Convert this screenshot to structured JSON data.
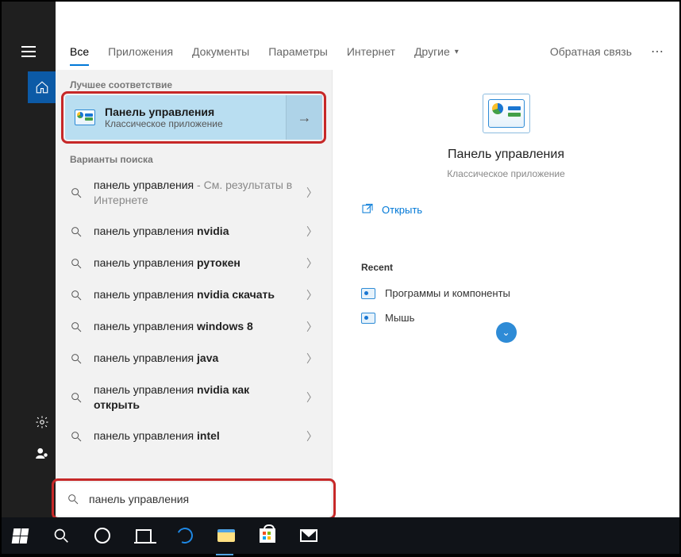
{
  "topnav": {
    "tabs": [
      "Все",
      "Приложения",
      "Документы",
      "Параметры",
      "Интернет",
      "Другие"
    ],
    "feedback": "Обратная связь"
  },
  "sections": {
    "best": "Лучшее соответствие",
    "variants": "Варианты поиска",
    "recent": "Recent"
  },
  "best_match": {
    "title": "Панель управления",
    "subtitle": "Классическое приложение"
  },
  "search_options": [
    {
      "prefix": "панель управления",
      "bold": "",
      "suffix": " - См. результаты в Интернете"
    },
    {
      "prefix": "панель управления ",
      "bold": "nvidia",
      "suffix": ""
    },
    {
      "prefix": "панель управления ",
      "bold": "рутокен",
      "suffix": ""
    },
    {
      "prefix": "панель управления ",
      "bold": "nvidia скачать",
      "suffix": ""
    },
    {
      "prefix": "панель управления ",
      "bold": "windows 8",
      "suffix": ""
    },
    {
      "prefix": "панель управления ",
      "bold": "java",
      "suffix": ""
    },
    {
      "prefix": "панель управления ",
      "bold": "nvidia как открыть",
      "suffix": ""
    },
    {
      "prefix": "панель управления ",
      "bold": "intel",
      "suffix": ""
    }
  ],
  "details": {
    "title": "Панель управления",
    "subtitle": "Классическое приложение",
    "open": "Открыть",
    "recent": [
      "Программы и компоненты",
      "Мышь"
    ]
  },
  "search_input": "панель управления"
}
